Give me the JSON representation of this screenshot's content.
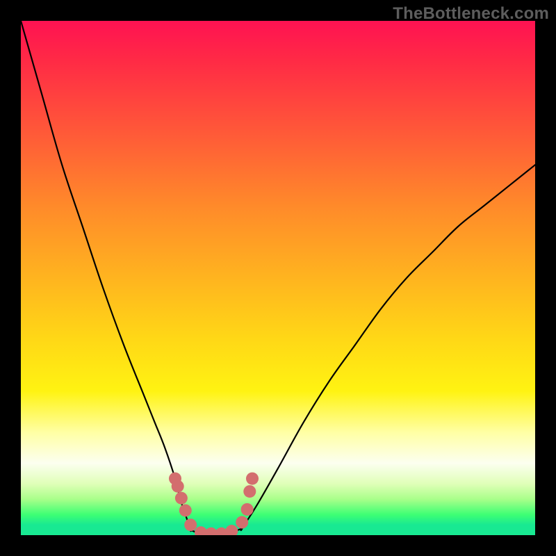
{
  "watermark": "TheBottleneck.com",
  "colors": {
    "background": "#000000",
    "curve": "#000000",
    "marker": "#d36e6e",
    "green_band": "#18e992"
  },
  "chart_data": {
    "type": "line",
    "title": "",
    "xlabel": "",
    "ylabel": "",
    "xlim": [
      0,
      100
    ],
    "ylim": [
      0,
      100
    ],
    "grid": false,
    "legend": false,
    "series": [
      {
        "name": "left-branch",
        "x": [
          0,
          4,
          8,
          12,
          16,
          20,
          24,
          26,
          28,
          30,
          31,
          32,
          33
        ],
        "values": [
          100,
          86,
          72,
          60,
          48,
          37,
          27,
          22,
          17,
          11,
          7,
          4,
          1
        ]
      },
      {
        "name": "valley-floor",
        "x": [
          33,
          34,
          35,
          36,
          37,
          38,
          39,
          40,
          41,
          42,
          43
        ],
        "values": [
          1,
          0.6,
          0.4,
          0.3,
          0.3,
          0.3,
          0.3,
          0.4,
          0.6,
          0.9,
          1.3
        ]
      },
      {
        "name": "right-branch",
        "x": [
          43,
          46,
          50,
          55,
          60,
          65,
          70,
          75,
          80,
          85,
          90,
          95,
          100
        ],
        "values": [
          1.3,
          6,
          13,
          22,
          30,
          37,
          44,
          50,
          55,
          60,
          64,
          68,
          72
        ]
      }
    ],
    "markers": {
      "name": "data-points",
      "x": [
        30,
        30.5,
        31.2,
        32,
        33,
        35,
        37,
        39,
        41,
        43,
        44,
        44.5,
        45
      ],
      "values": [
        11,
        9.5,
        7.2,
        4.8,
        2.0,
        0.5,
        0.3,
        0.3,
        0.8,
        2.5,
        5.0,
        8.5,
        11
      ]
    }
  }
}
